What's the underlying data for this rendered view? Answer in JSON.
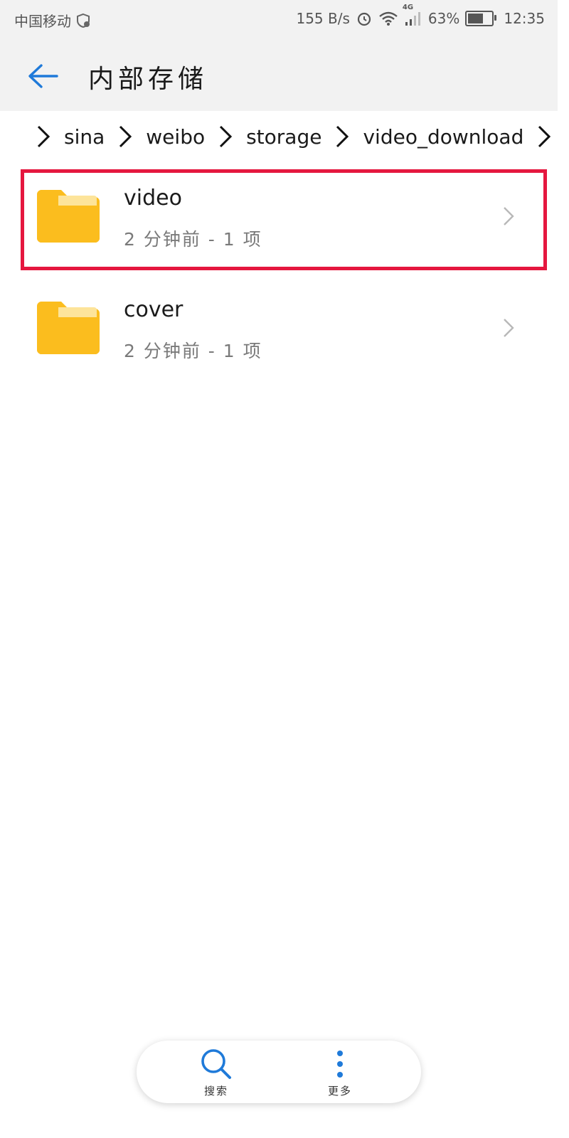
{
  "status_bar": {
    "carrier": "中国移动",
    "net_speed": "155 B/s",
    "network_type": "4G",
    "battery": "63%",
    "battery_level": 0.63,
    "time": "12:35"
  },
  "app_bar": {
    "title": "内部存储"
  },
  "breadcrumb": {
    "items": [
      "sina",
      "weibo",
      "storage",
      "video_download"
    ]
  },
  "files": [
    {
      "name": "video",
      "meta": "2 分钟前 - 1 项"
    },
    {
      "name": "cover",
      "meta": "2 分钟前 - 1 项"
    }
  ],
  "bottom_nav": {
    "search_label": "搜索",
    "more_label": "更多"
  },
  "colors": {
    "accent": "#1f7ad9",
    "folder": "#fbbd1e",
    "highlight": "#e5173f"
  }
}
